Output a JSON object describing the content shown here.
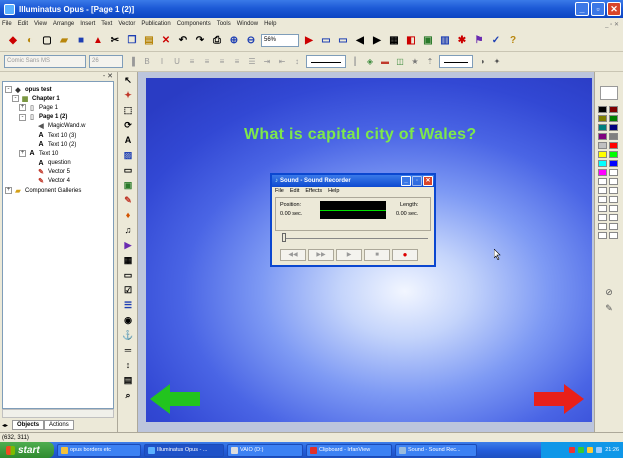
{
  "window": {
    "title": "Illuminatus Opus - [Page 1 (2)]"
  },
  "menu": [
    "File",
    "Edit",
    "View",
    "Arrange",
    "Insert",
    "Text",
    "Vector",
    "Publication",
    "Components",
    "Tools",
    "Window",
    "Help"
  ],
  "toolbar": {
    "zoom_value": "56%"
  },
  "format_bar": {
    "font_value": "Comic Sans MS",
    "size_value": "26"
  },
  "tree": {
    "nodes": [
      {
        "label": "opus test",
        "bold": true,
        "depth": 0,
        "expander": "-",
        "icon": "publication-icon"
      },
      {
        "label": "Chapter 1",
        "bold": true,
        "depth": 1,
        "expander": "-",
        "icon": "chapter-icon"
      },
      {
        "label": "Page 1",
        "bold": false,
        "depth": 2,
        "expander": "+",
        "icon": "page-icon"
      },
      {
        "label": "Page 1 (2)",
        "bold": true,
        "depth": 2,
        "expander": "-",
        "icon": "page-icon"
      },
      {
        "label": "MagicWand.w",
        "bold": false,
        "depth": 3,
        "expander": "",
        "icon": "sound-icon"
      },
      {
        "label": "Text 10 (3)",
        "bold": false,
        "depth": 3,
        "expander": "",
        "icon": "text-icon"
      },
      {
        "label": "Text 10 (2)",
        "bold": false,
        "depth": 3,
        "expander": "",
        "icon": "text-icon"
      },
      {
        "label": "Text 10",
        "bold": false,
        "depth": 3,
        "expander": "+",
        "icon": "text-icon"
      },
      {
        "label": "question",
        "bold": false,
        "depth": 3,
        "expander": "",
        "icon": "text-icon"
      },
      {
        "label": "Vector 5",
        "bold": false,
        "depth": 3,
        "expander": "",
        "icon": "vector-icon"
      },
      {
        "label": "Vector 4",
        "bold": false,
        "depth": 3,
        "expander": "",
        "icon": "vector-icon"
      },
      {
        "label": "Component Galleries",
        "bold": false,
        "depth": 0,
        "expander": "+",
        "icon": "folder-icon"
      }
    ],
    "tabs": [
      "Objects",
      "Actions"
    ]
  },
  "slide": {
    "question": "What is capital city of Wales?",
    "left_arrow_color": "#22c41e",
    "right_arrow_color": "#e8201a",
    "background_color": "#3a52d8"
  },
  "dialog": {
    "title": "Sound - Sound Recorder",
    "menu": [
      "File",
      "Edit",
      "Effects",
      "Help"
    ],
    "position_label": "Position:",
    "position_value": "0.00 sec.",
    "length_label": "Length:",
    "length_value": "0.00 sec."
  },
  "status": {
    "coords": "(632, 311)"
  },
  "taskbar": {
    "start": "start",
    "tasks": [
      "opus borders etc",
      "Illuminatus Opus - ...",
      "VAIO (D:)",
      "Clipboard - IrfanView",
      "Sound - Sound Rec..."
    ],
    "clock": "21:26"
  }
}
